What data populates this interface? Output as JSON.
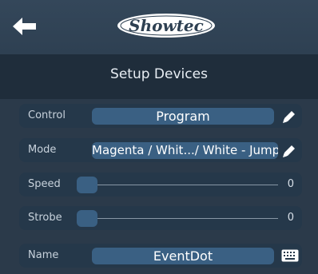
{
  "header": {
    "logo_text": "Showtec",
    "title": "Setup Devices"
  },
  "rows": {
    "control": {
      "label": "Control",
      "value": "Program",
      "icon": "pencil-icon"
    },
    "mode": {
      "label": "Mode",
      "value": "Magenta / Whit.../ White - Jump",
      "icon": "pencil-icon"
    },
    "speed": {
      "label": "Speed",
      "value": "0"
    },
    "strobe": {
      "label": "Strobe",
      "value": "0"
    },
    "name": {
      "label": "Name",
      "value": "EventDot",
      "icon": "keyboard-icon"
    }
  },
  "colors": {
    "accent": "#3a6083",
    "background": "#2b3a4a",
    "header": "#1f2d3b"
  }
}
